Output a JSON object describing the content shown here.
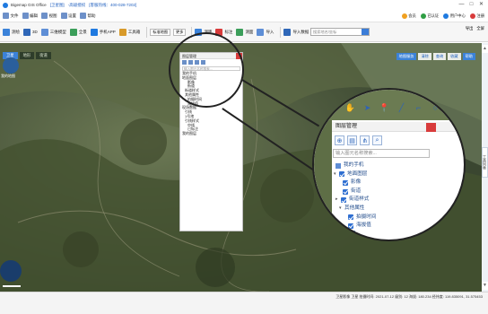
{
  "titlebar": {
    "app_name": "Bigemap GIS Office",
    "mode": "[卫星图]",
    "edition": "-高级授权",
    "support": "[客服热线：400-028-7202]",
    "window_controls": [
      "—",
      "□",
      "✕"
    ]
  },
  "toolbar1": {
    "items": [
      "文件",
      "编辑",
      "视图",
      "设置",
      "帮助"
    ],
    "right_pills": [
      {
        "label": "会员",
        "color": "#f0a020"
      },
      {
        "label": "已认证",
        "color": "#2f9e44"
      },
      {
        "label": "用户中心",
        "color": "#1f7ae0"
      },
      {
        "label": "注册",
        "color": "#d83b3b"
      }
    ]
  },
  "toolbar2": {
    "left_tools": [
      "测绘",
      "3D",
      "三维模型",
      "全景",
      "手机APP",
      "工具箱"
    ],
    "selects": [
      "标准地图",
      "更多"
    ],
    "buttons": [
      "测距",
      "标注",
      "测面",
      "导入",
      "导入数据",
      "坐标转换",
      "导出",
      "导出图片",
      "导入/导出"
    ],
    "search_placeholder": "搜索地名/坐标",
    "right_items": [
      "导出",
      "全屏"
    ]
  },
  "map": {
    "tabs": [
      "卫星",
      "地形",
      "街道"
    ],
    "earth_label": "我的地图",
    "right_buttons": [
      "地图服务",
      "清除",
      "查询",
      "收藏",
      "帮助"
    ],
    "rail_label": "工具列表"
  },
  "small_layer_panel": {
    "title": "图层管理",
    "search_placeholder": "输入图元名称搜索...",
    "items": [
      "我的手机",
      "地面图层",
      "影像",
      "街道",
      "街道样式",
      "其他属性",
      "拍摄时间",
      "海拔值",
      "现场数据",
      "引线",
      "1号地",
      "引线样式",
      "中线",
      "已标注",
      "我的图层"
    ]
  },
  "zoom_panel": {
    "title": "图层管理",
    "search_placeholder": "输入图元名称搜索...",
    "tools": [
      "✋",
      "➤",
      "📍",
      "╱",
      "⌐",
      "○",
      "▢"
    ],
    "rows": [
      {
        "type": "plain",
        "label": "我的手机"
      },
      {
        "type": "open",
        "label": "地面图层"
      },
      {
        "type": "check",
        "label": "影像"
      },
      {
        "type": "check",
        "label": "街道"
      },
      {
        "type": "arrow",
        "label": "街道样式"
      },
      {
        "type": "open",
        "label": "其他属性"
      },
      {
        "type": "check",
        "label": "拍摄时间"
      },
      {
        "type": "check",
        "label": "海拔值"
      },
      {
        "type": "plain",
        "label": "现场数据"
      },
      {
        "type": "plain",
        "label": "引线"
      }
    ]
  },
  "statusbar": {
    "text": "卫星影像 卫星  拍摄时间: 2021-07-12  级别: 12   海拔: 180.234   经纬度: 119.835091, 31.575453"
  }
}
